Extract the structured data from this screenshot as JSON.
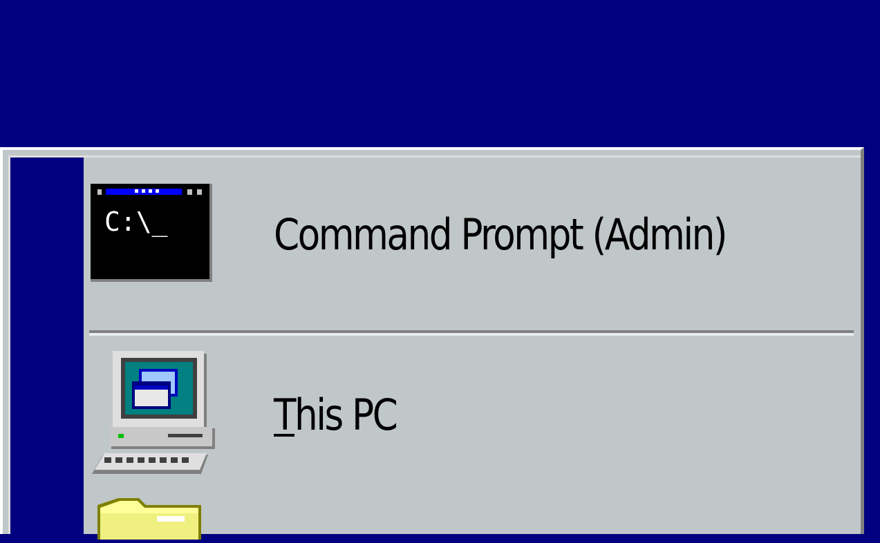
{
  "menu": {
    "items": [
      {
        "id": "command-prompt-admin",
        "label": "Command Prompt (Admin)",
        "icon": "command-prompt-icon",
        "icon_text": "C:\\_"
      },
      {
        "id": "this-pc",
        "accelerator": "T",
        "label_rest": "his PC",
        "icon": "computer-icon"
      },
      {
        "id": "folder",
        "icon": "folder-icon"
      }
    ]
  },
  "colors": {
    "desktop": "#000080",
    "menu_face": "#c0c7c8",
    "banner": "#000080",
    "highlight": "#ffffff",
    "shadow": "#808080"
  }
}
